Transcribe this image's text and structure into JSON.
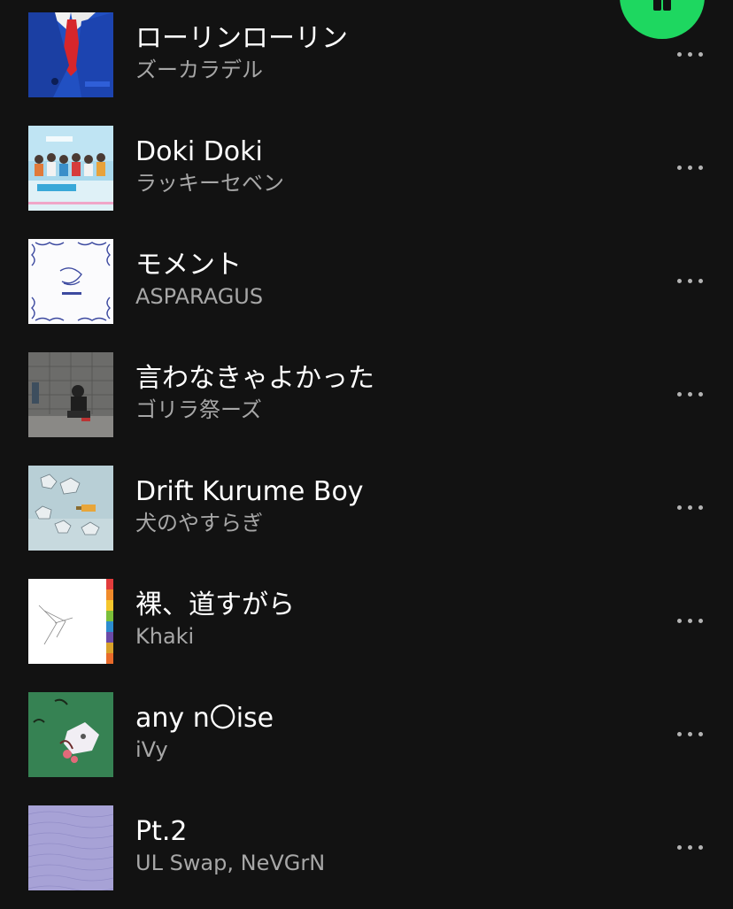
{
  "player": {
    "play_button_icon": "pause-icon",
    "accent_color": "#1ed760"
  },
  "tracks": [
    {
      "title": "ローリンローリン",
      "artist": "ズーカラデル",
      "cover": "blue-suit-red-tie"
    },
    {
      "title": "Doki Doki",
      "artist": "ラッキーセベン",
      "cover": "group-photo-light-blue"
    },
    {
      "title": "モメント",
      "artist": "ASPARAGUS",
      "cover": "white-ornate-frame"
    },
    {
      "title": "言わなきゃよかった",
      "artist": "ゴリラ祭ーズ",
      "cover": "person-crouching-gray-wall"
    },
    {
      "title": "Drift Kurume Boy",
      "artist": "犬のやすらぎ",
      "cover": "pale-blue-collage"
    },
    {
      "title": "裸、道すがら",
      "artist": "Khaki",
      "cover": "white-line-sketch-color-bar"
    },
    {
      "title": "any n〇ise",
      "artist": "iVy",
      "cover": "green-plush-toy"
    },
    {
      "title": "Pt.2",
      "artist": "UL Swap, NeVGrN",
      "cover": "lavender-moire"
    }
  ],
  "more_icon": "more-dots-icon",
  "colors": {
    "background": "#121212",
    "title_text": "#ffffff",
    "artist_text": "#a7a7a7"
  }
}
